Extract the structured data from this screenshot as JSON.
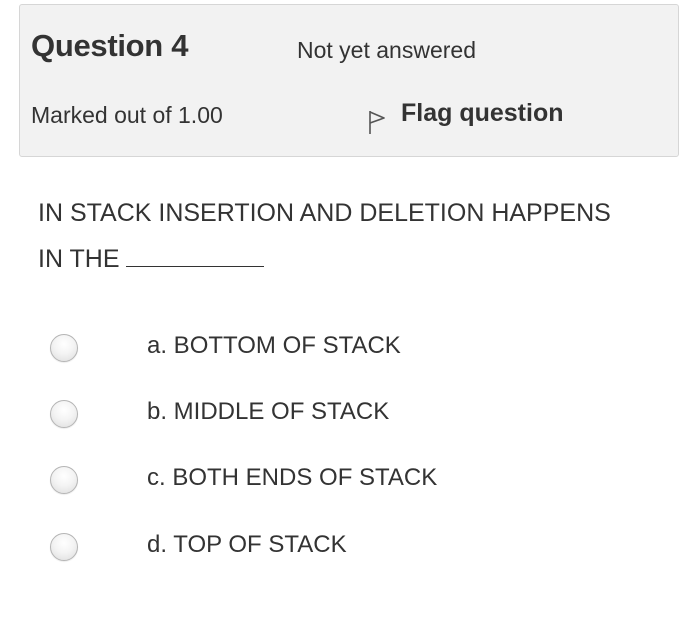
{
  "info": {
    "title": "Question 4",
    "state": "Not yet answered",
    "grade": "Marked out of 1.00",
    "flag_label": "Flag question"
  },
  "question": {
    "line1": "IN STACK INSERTION AND DELETION HAPPENS",
    "line2": "IN THE"
  },
  "options": [
    {
      "label": "a. BOTTOM OF STACK",
      "selected": false
    },
    {
      "label": "b. MIDDLE OF STACK",
      "selected": false
    },
    {
      "label": "c. BOTH ENDS OF STACK",
      "selected": false
    },
    {
      "label": "d. TOP OF STACK",
      "selected": false
    }
  ],
  "colors": {
    "text": "#333333",
    "info_bg": "#f2f2f2",
    "info_border": "#d6d6d6"
  },
  "icons": {
    "flag": "flag-outline-icon"
  }
}
